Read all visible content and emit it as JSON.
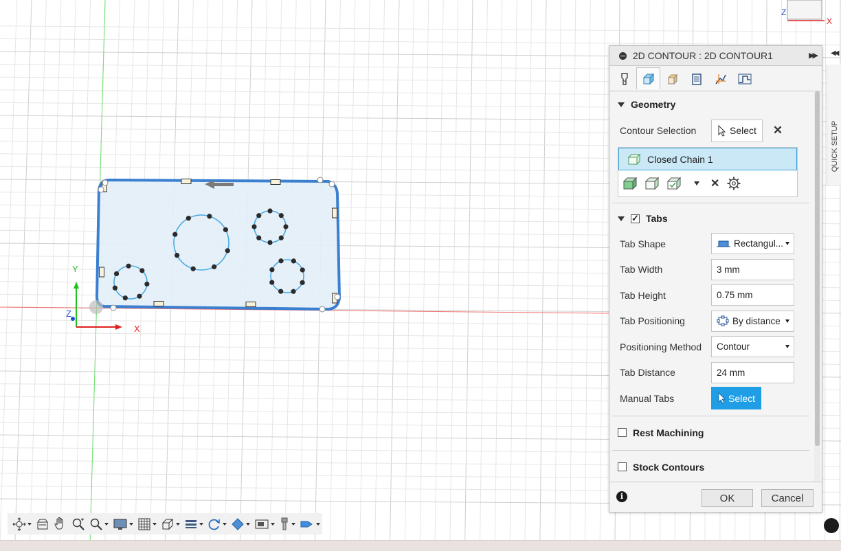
{
  "viewport": {
    "axes": {
      "x_label": "X",
      "y_label": "Y",
      "z_label": "Z"
    },
    "viewcube": {
      "x_label": "X",
      "z_label": "Z"
    }
  },
  "panel": {
    "title": "2D CONTOUR : 2D CONTOUR1",
    "tabs": [
      {
        "name": "tool-tab-icon"
      },
      {
        "name": "geometry-tab-icon"
      },
      {
        "name": "heights-tab-icon"
      },
      {
        "name": "passes-tab-icon"
      },
      {
        "name": "linking-tab-icon"
      },
      {
        "name": "post-tab-icon"
      }
    ],
    "geometry": {
      "heading": "Geometry",
      "contour_selection_label": "Contour Selection",
      "select_label": "Select",
      "chain_item": "Closed Chain 1"
    },
    "tabs_section": {
      "heading": "Tabs",
      "checked": true,
      "tab_shape_label": "Tab Shape",
      "tab_shape_value": "Rectangul...",
      "tab_width_label": "Tab Width",
      "tab_width_value": "3 mm",
      "tab_height_label": "Tab Height",
      "tab_height_value": "0.75 mm",
      "tab_positioning_label": "Tab Positioning",
      "tab_positioning_value": "By distance",
      "positioning_method_label": "Positioning Method",
      "positioning_method_value": "Contour",
      "tab_distance_label": "Tab Distance",
      "tab_distance_value": "24 mm",
      "manual_tabs_label": "Manual Tabs",
      "manual_tabs_select": "Select"
    },
    "rest_machining": {
      "heading": "Rest Machining",
      "checked": false
    },
    "stock_contours": {
      "heading": "Stock Contours",
      "checked": false
    },
    "ok_label": "OK",
    "cancel_label": "Cancel"
  },
  "quick_setup_label": "QUICK SETUP",
  "toolbar": {
    "items": [
      "orbit-icon",
      "look-at-icon",
      "pan-icon",
      "zoom-icon",
      "fit-icon",
      "display-settings-icon",
      "grid-icon",
      "viewports-icon",
      "named-views-icon",
      "rotate-icon",
      "appearance-icon",
      "effects-icon",
      "tool-icon",
      "sim-icon"
    ]
  },
  "colors": {
    "accent": "#1f9ee6",
    "selection_fill": "#cbe8f6",
    "contour_blue": "#3b7fd1",
    "axis_red": "#e02020",
    "axis_green": "#1ec21e"
  }
}
